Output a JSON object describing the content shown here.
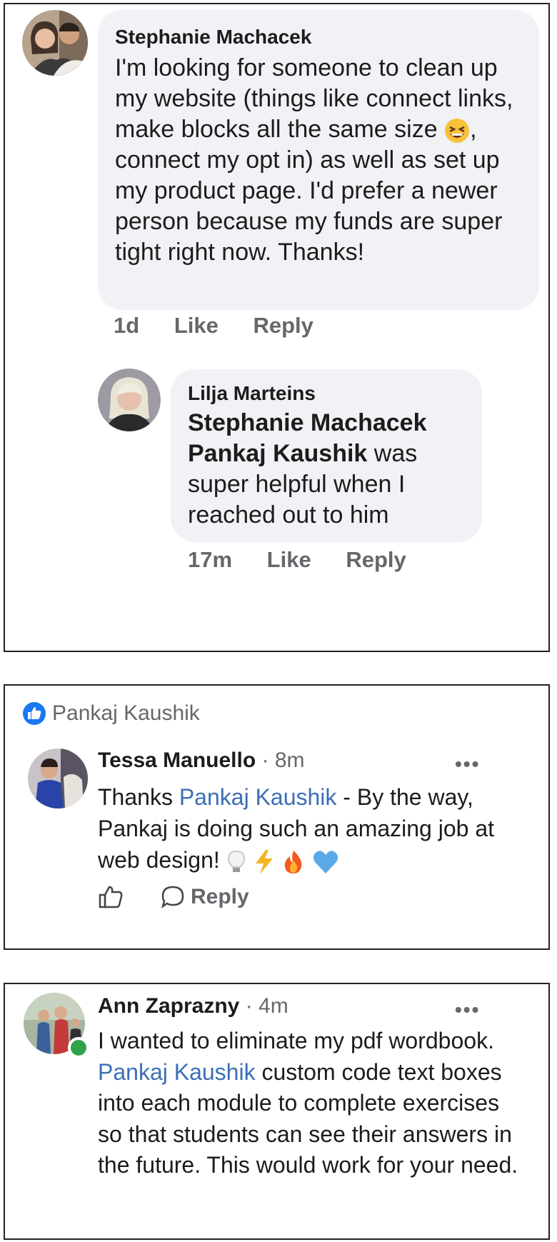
{
  "comment1": {
    "author": "Stephanie Machacek",
    "text_before_emoji": "I'm looking for someone to clean up my website (things like connect links, make blocks all the same size",
    "emoji": "grinning-squinting-face",
    "text_after_emoji": ", connect my opt in) as well as set up my product page. I'd prefer a newer person because my funds are super tight right now. Thanks!",
    "time": "1d",
    "like_label": "Like",
    "reply_label": "Reply"
  },
  "reply1": {
    "author": "Lilja Marteins",
    "mention1": "Stephanie Machacek",
    "mention2": "Pankaj Kaushik",
    "text": " was super helpful when I reached out to him",
    "time": "17m",
    "like_label": "Like",
    "reply_label": "Reply"
  },
  "comment2": {
    "liked_by": "Pankaj Kaushik",
    "author": "Tessa Manuello",
    "separator": "·",
    "time": "8m",
    "text_prefix": "Thanks ",
    "mention": "Pankaj Kaushik",
    "text_suffix": " - By the way, Pankaj is doing such an amazing job at web design!",
    "emojis": [
      "lightbulb",
      "lightning",
      "fire",
      "blue-heart"
    ],
    "reply_label": "Reply",
    "more_label": "•••"
  },
  "comment3": {
    "author": "Ann Zaprazny",
    "separator": "·",
    "time": "4m",
    "text_prefix": "I wanted to eliminate my pdf wordbook.  ",
    "mention": "Pankaj Kaushik",
    "text_suffix": " custom code text boxes into each module to complete exercises so that students can see their answers in the future. This would work for your need.",
    "more_label": "•••"
  },
  "colors": {
    "link": "#3b6fb6",
    "meta": "#65676b",
    "bubble": "#f0f2f5",
    "online": "#31a24c",
    "like_badge": "#1877f2"
  }
}
